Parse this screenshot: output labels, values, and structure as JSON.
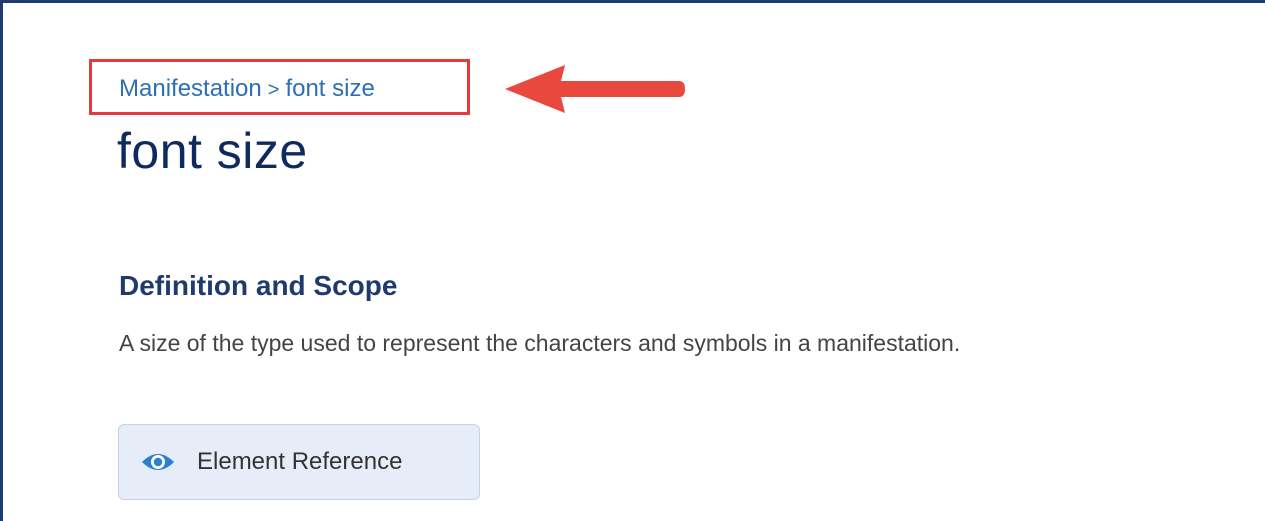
{
  "breadcrumb": {
    "parent": "Manifestation",
    "separator": ">",
    "current": "font size"
  },
  "page": {
    "title": "font size"
  },
  "definition_section": {
    "heading": "Definition and Scope",
    "text": "A size of the type used to represent the characters and symbols in a manifestation."
  },
  "element_reference_button": {
    "label": "Element Reference",
    "icon": "eye-icon"
  },
  "annotations": {
    "highlight_box_color": "#e23b3b",
    "arrow_color": "#e8483e",
    "arrow_icon": "left-arrow-icon"
  },
  "colors": {
    "frame_border": "#1f3b6e",
    "link": "#2c6fb7",
    "title": "#0f2a5c",
    "button_bg": "#e7edf8"
  }
}
